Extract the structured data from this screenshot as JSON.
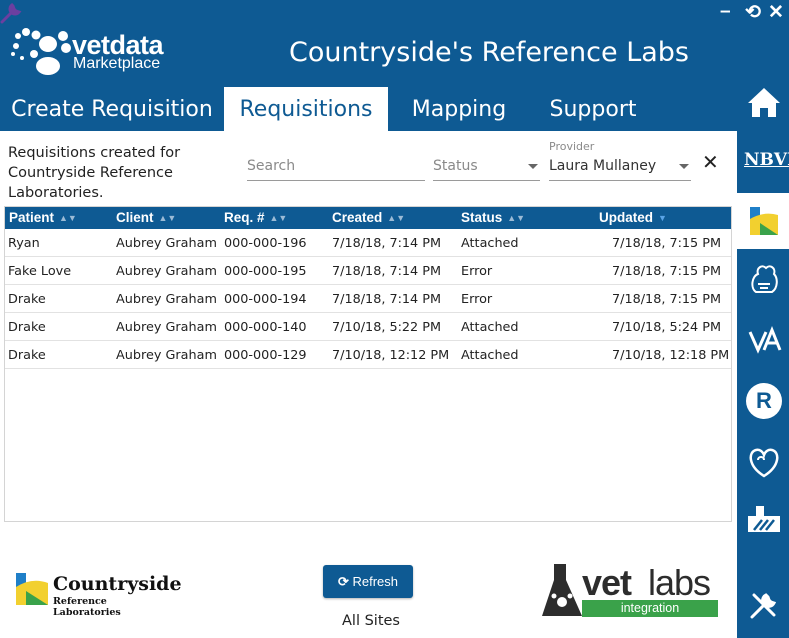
{
  "app": {
    "title": "Countryside's Reference Labs"
  },
  "logo": {
    "word": "vetdata",
    "sub": "Marketplace"
  },
  "window": {
    "minimize": "–",
    "restore": "⟲",
    "close": "✕"
  },
  "tabs": [
    {
      "label": "Create Requisition"
    },
    {
      "label": "Requisitions",
      "active": true
    },
    {
      "label": "Mapping"
    },
    {
      "label": "Support"
    }
  ],
  "rail": {
    "nbvl_label": "NBVL",
    "rx_label": "R"
  },
  "filters": {
    "description": "Requisitions created for Countryside Reference Laboratories.",
    "search_placeholder": "Search",
    "status_placeholder": "Status",
    "provider_label": "Provider",
    "provider_value": "Laura Mullaney",
    "clear": "✕"
  },
  "table": {
    "columns": [
      "Patient",
      "Client",
      "Req. #",
      "Created",
      "Status",
      "Updated"
    ],
    "rows": [
      {
        "patient": "Ryan",
        "client": "Aubrey Graham",
        "req": "000-000-196",
        "created": "7/18/18, 7:14 PM",
        "status": "Attached",
        "updated": "7/18/18, 7:15 PM"
      },
      {
        "patient": "Fake Love",
        "client": "Aubrey Graham",
        "req": "000-000-195",
        "created": "7/18/18, 7:14 PM",
        "status": "Error",
        "updated": "7/18/18, 7:15 PM"
      },
      {
        "patient": "Drake",
        "client": "Aubrey Graham",
        "req": "000-000-194",
        "created": "7/18/18, 7:14 PM",
        "status": "Error",
        "updated": "7/18/18, 7:15 PM"
      },
      {
        "patient": "Drake",
        "client": "Aubrey Graham",
        "req": "000-000-140",
        "created": "7/10/18, 5:22 PM",
        "status": "Attached",
        "updated": "7/10/18, 5:24 PM"
      },
      {
        "patient": "Drake",
        "client": "Aubrey Graham",
        "req": "000-000-129",
        "created": "7/10/18, 12:12 PM",
        "status": "Attached",
        "updated": "7/10/18, 12:18 PM"
      }
    ]
  },
  "footer": {
    "countryside_name": "Countryside",
    "countryside_sub": "Reference Laboratories",
    "refresh_label": "Refresh",
    "sites_label": "All Sites",
    "vetlabs_word1": "vet",
    "vetlabs_word2": "labs",
    "vetlabs_sub": "integration"
  },
  "colors": {
    "brand": "#0e5a93",
    "green": "#3aa24a",
    "yellow": "#f2d02f",
    "purple": "#6b3fa0"
  }
}
